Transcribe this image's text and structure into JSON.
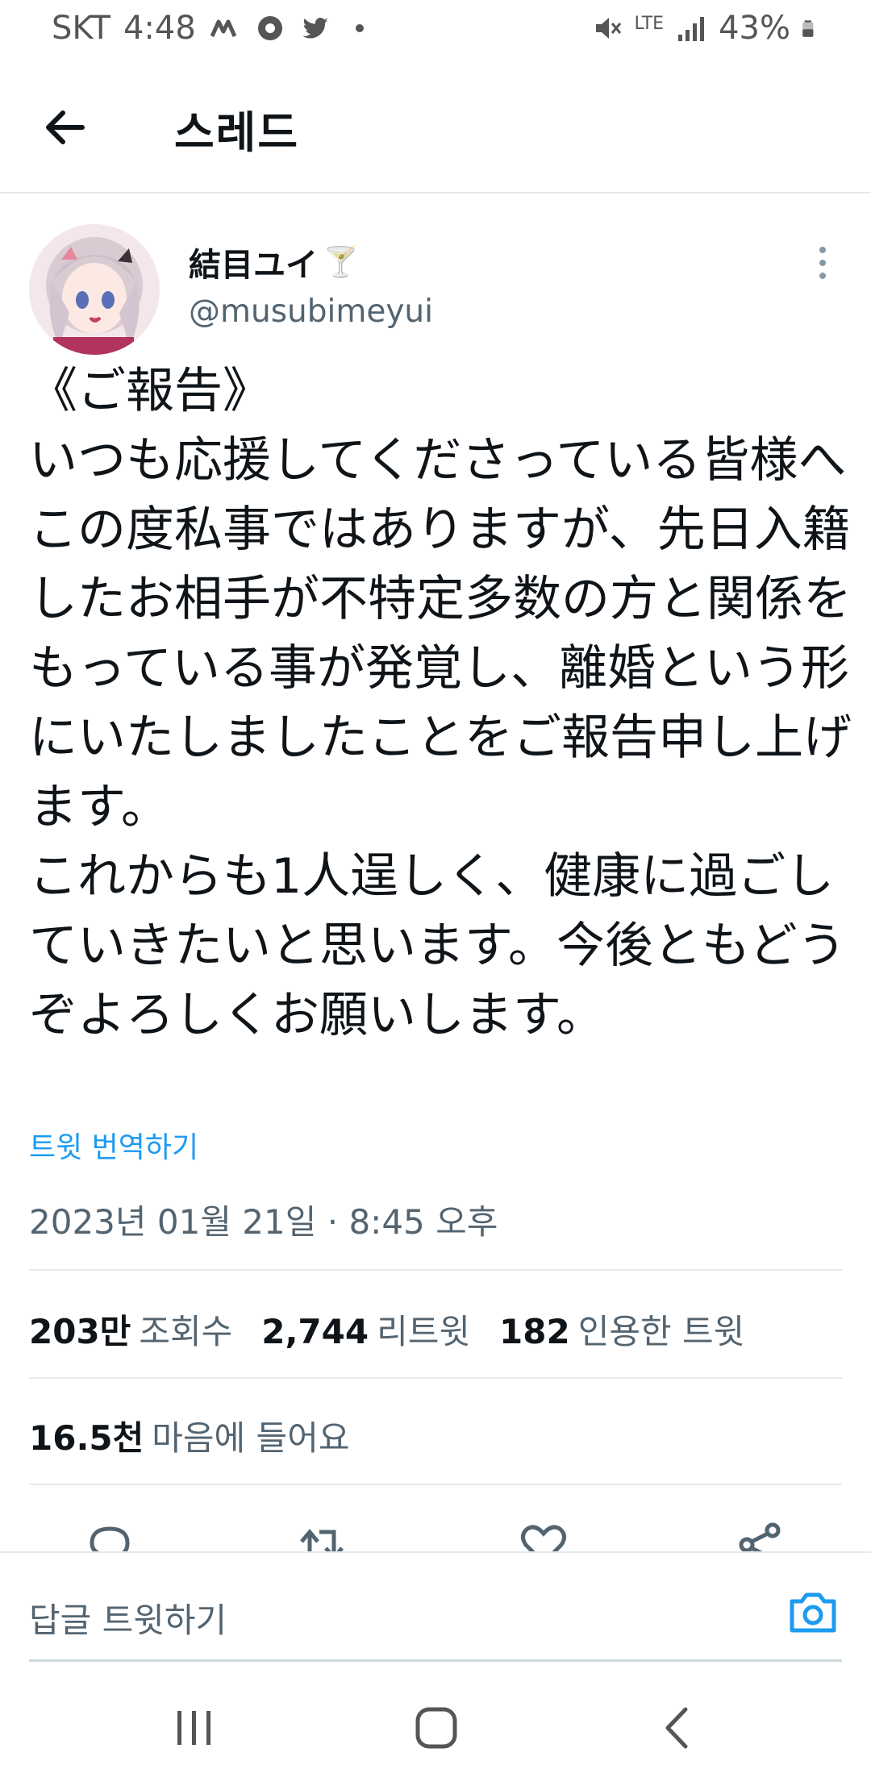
{
  "status_bar": {
    "carrier": "SKT",
    "time": "4:48",
    "network": "LTE",
    "battery": "43%"
  },
  "header": {
    "title": "스레드"
  },
  "tweet": {
    "display_name": "結目ユイ",
    "name_emoji": "🍸",
    "handle": "@musubimeyui",
    "text": "《ご報告》\nいつも応援してくださっている皆様へ\nこの度私事ではありますが、先日入籍したお相手が不特定多数の方と関係をもっている事が発覚し、離婚という形にいたしましたことをご報告申し上げます。\nこれからも1人逞しく、健康に過ごしていきたいと思います。今後ともどうぞよろしくお願いします。",
    "translate_label": "트윗 번역하기",
    "timestamp": "2023년 01월 21일 · 8:45 오후",
    "stats": {
      "views_count": "203만",
      "views_label": "조회수",
      "retweets_count": "2,744",
      "retweets_label": "리트윗",
      "quotes_count": "182",
      "quotes_label": "인용한 트윗",
      "likes_count": "16.5천",
      "likes_label": "마음에 들어요"
    }
  },
  "reply": {
    "placeholder": "답글 트윗하기"
  },
  "colors": {
    "accent": "#1d9bf0",
    "text_primary": "#0f1419",
    "text_secondary": "#536471",
    "divider": "#e6e9ec"
  },
  "icons": {
    "back": "arrow-left-icon",
    "more": "more-vertical-icon",
    "reply": "reply-icon",
    "retweet": "retweet-icon",
    "like": "heart-icon",
    "share": "share-icon",
    "camera": "camera-icon"
  }
}
